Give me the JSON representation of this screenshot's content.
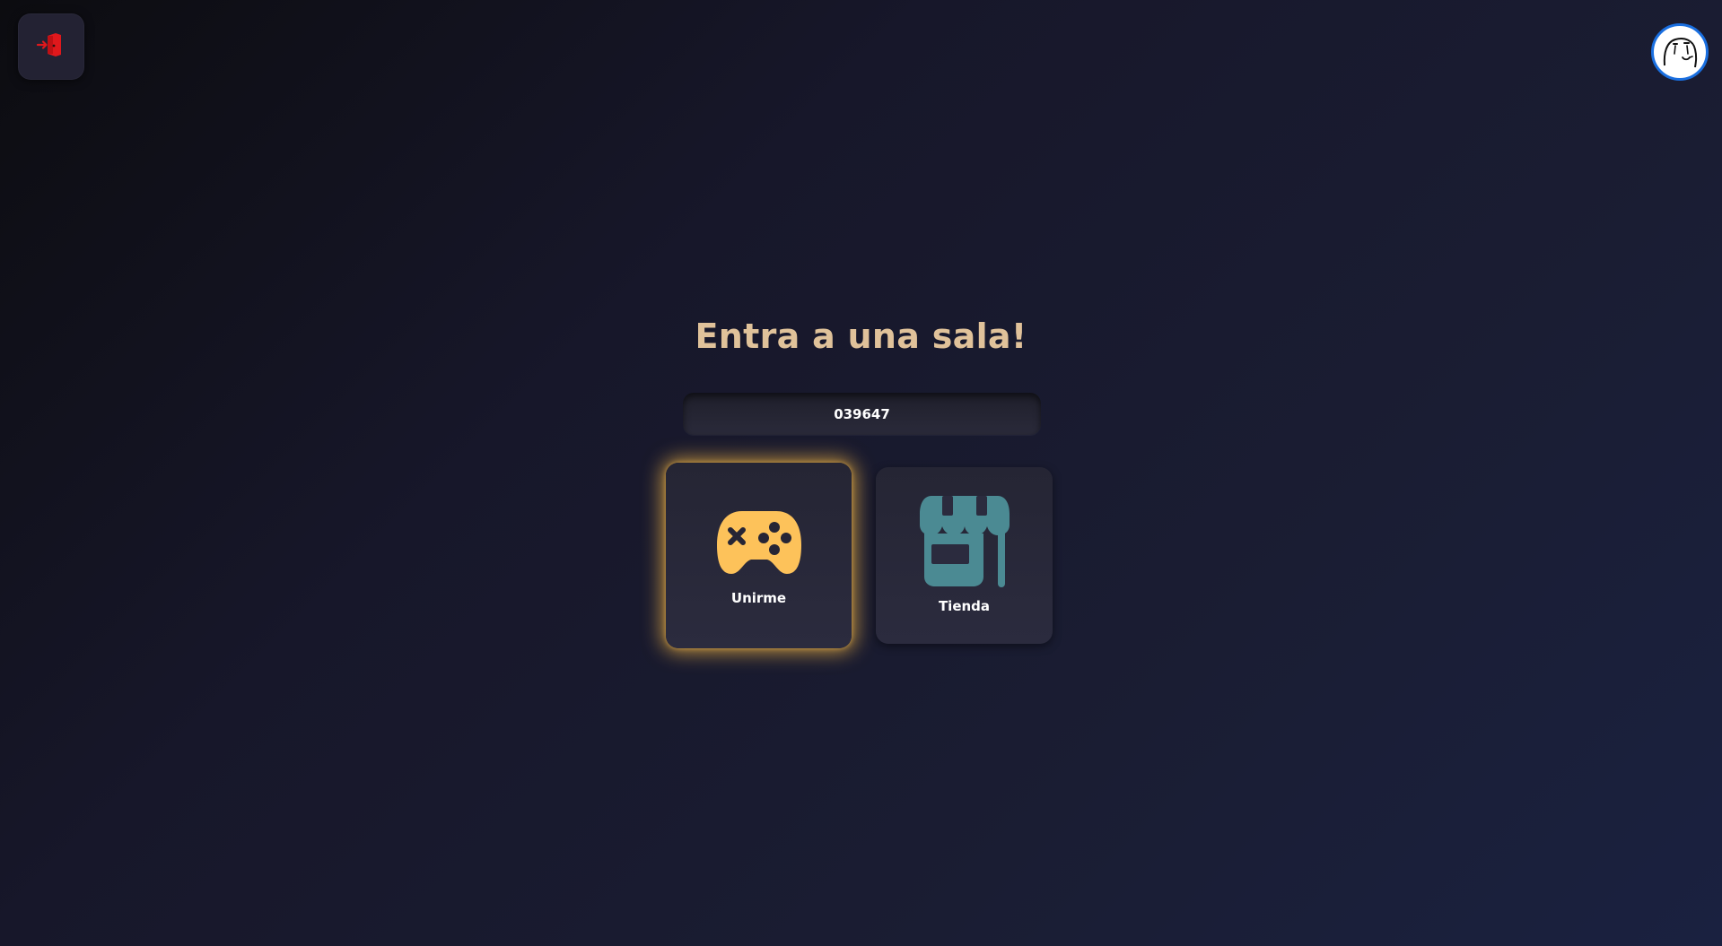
{
  "header": {
    "logout_icon": "door-exit-icon",
    "avatar_icon": "meme-face-avatar"
  },
  "main": {
    "title": "Entra a una sala!",
    "room_code": {
      "value": "039647",
      "placeholder": ""
    },
    "cards": [
      {
        "label": "Unirme",
        "icon": "gamepad-icon",
        "icon_color": "#fdc25a",
        "selected": true
      },
      {
        "label": "Tienda",
        "icon": "storefront-icon",
        "icon_color": "#4b8a93",
        "selected": false
      }
    ]
  },
  "colors": {
    "title": "#e0c29a",
    "logout_icon": "#e0181c",
    "avatar_border": "#1a6fe0",
    "selected_glow": "#f5b846"
  }
}
